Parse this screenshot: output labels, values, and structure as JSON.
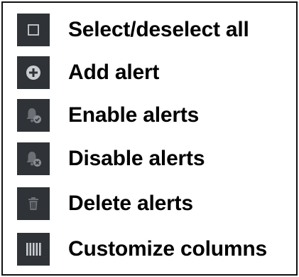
{
  "menu": {
    "items": [
      {
        "label": "Select/deselect all",
        "icon": "checkbox-icon"
      },
      {
        "label": "Add alert",
        "icon": "plus-circle-icon"
      },
      {
        "label": "Enable alerts",
        "icon": "bell-check-icon"
      },
      {
        "label": "Disable alerts",
        "icon": "bell-x-icon"
      },
      {
        "label": "Delete alerts",
        "icon": "trash-icon"
      },
      {
        "label": "Customize columns",
        "icon": "columns-icon"
      }
    ]
  },
  "colors": {
    "icon_bg": "#2f3236",
    "icon_fg": "#c9cdd2",
    "icon_fg_dim": "#6c7076",
    "text": "#000000",
    "border": "#111111"
  }
}
